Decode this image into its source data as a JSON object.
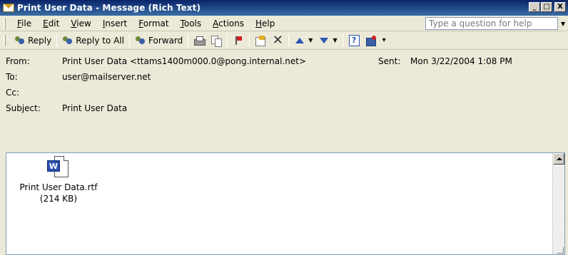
{
  "window": {
    "title": "Print User Data - Message (Rich Text)",
    "controls": {
      "minimize": "_",
      "maximize": "□",
      "close": "X"
    }
  },
  "menu": {
    "items": [
      "File",
      "Edit",
      "View",
      "Insert",
      "Format",
      "Tools",
      "Actions",
      "Help"
    ],
    "help_placeholder": "Type a question for help"
  },
  "toolbar": {
    "reply": "Reply",
    "reply_all": "Reply to All",
    "forward": "Forward",
    "icons": [
      "reply-icon",
      "reply-all-icon",
      "forward-icon",
      "print-icon",
      "copy-icon",
      "flag-icon",
      "move-to-folder-icon",
      "delete-icon",
      "previous-item-icon",
      "next-item-icon",
      "help-icon",
      "address-book-icon"
    ]
  },
  "header": {
    "from_label": "From:",
    "from_value": "Print User Data <ttams1400m000.0@pong.internal.net>",
    "sent_label": "Sent:",
    "sent_value": "Mon 3/22/2004 1:08 PM",
    "to_label": "To:",
    "to_value": "user@mailserver.net",
    "cc_label": "Cc:",
    "cc_value": "",
    "subject_label": "Subject:",
    "subject_value": "Print User Data"
  },
  "body": {
    "attachment": {
      "name": "Print User Data.rtf",
      "size": "(214 KB)",
      "icon": "word-document-icon",
      "icon_letter": "W"
    }
  }
}
